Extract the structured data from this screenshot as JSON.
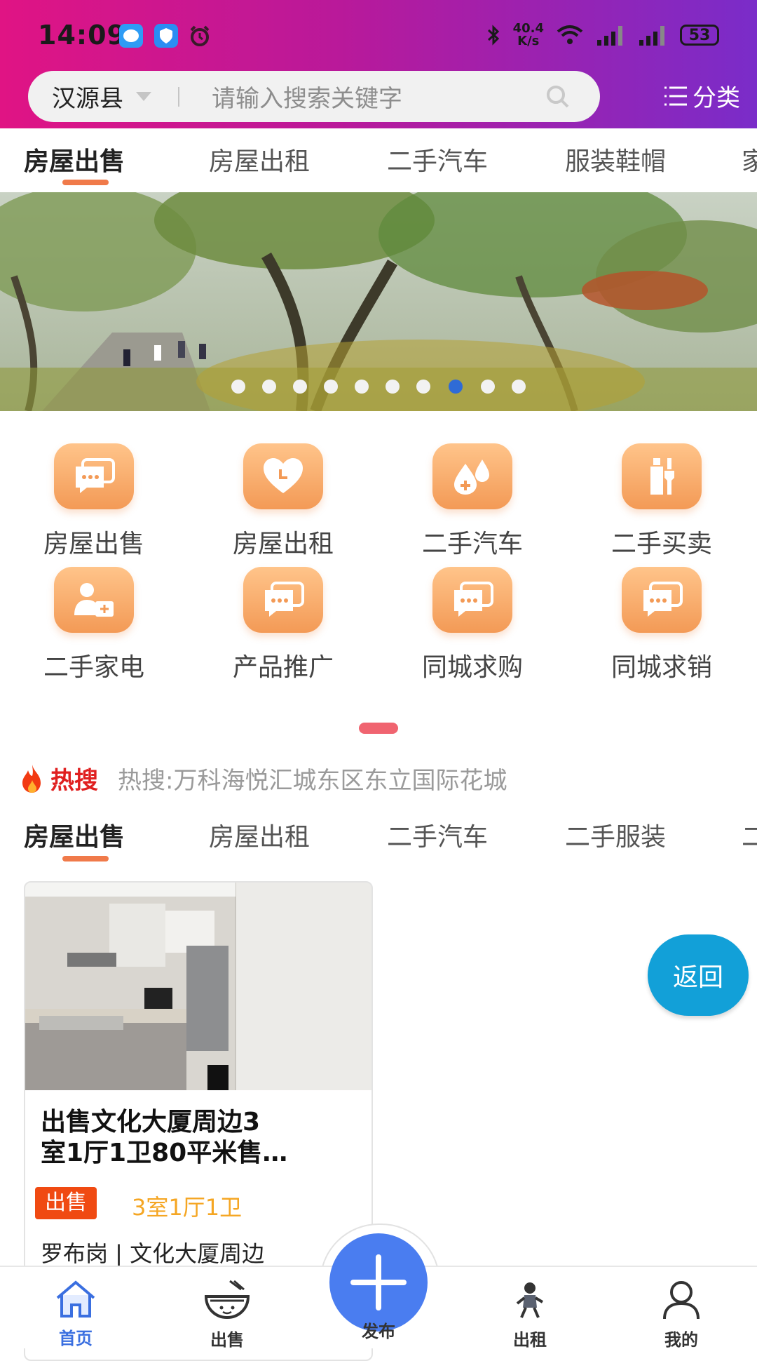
{
  "status": {
    "time": "14:09",
    "speed_top": "40.4",
    "speed_bottom": "K/s",
    "battery": "53"
  },
  "search": {
    "city": "汉源县",
    "placeholder": "请输入搜索关键字",
    "category": "分类"
  },
  "top_tabs": [
    "房屋出售",
    "房屋出租",
    "二手汽车",
    "服装鞋帽",
    "家"
  ],
  "banner": {
    "dot_count": 10,
    "active_dot": 7
  },
  "grid": [
    {
      "label": "房屋出售",
      "icon": "chat-bubbles-icon"
    },
    {
      "label": "房屋出租",
      "icon": "heart-icon"
    },
    {
      "label": "二手汽车",
      "icon": "drops-icon"
    },
    {
      "label": "二手买卖",
      "icon": "bottles-icon"
    },
    {
      "label": "二手家电",
      "icon": "doctor-kit-icon"
    },
    {
      "label": "产品推广",
      "icon": "chat-bubbles-icon"
    },
    {
      "label": "同城求购",
      "icon": "chat-bubbles-icon"
    },
    {
      "label": "同城求销",
      "icon": "chat-bubbles-icon"
    }
  ],
  "hot": {
    "label": "热搜",
    "text": "热搜:万科海悦汇城东区东立国际花城"
  },
  "list_tabs": [
    "房屋出售",
    "房屋出租",
    "二手汽车",
    "二手服装",
    "二"
  ],
  "card": {
    "title_line1": "出售文化大厦周边3",
    "title_line2": "室1厅1卫80平米售…",
    "badge": "出售",
    "rooms": "3室1厅1卫",
    "location": "罗布岗 | 文化大厦周边"
  },
  "back_button": "返回",
  "nav": {
    "home": "首页",
    "sell": "出售",
    "publish": "发布",
    "rent": "出租",
    "mine": "我的"
  },
  "colors": {
    "accent": "#f07a4a",
    "nav_active": "#3a6fe0",
    "fab": "#4a7df0",
    "back": "#12a0d8"
  }
}
